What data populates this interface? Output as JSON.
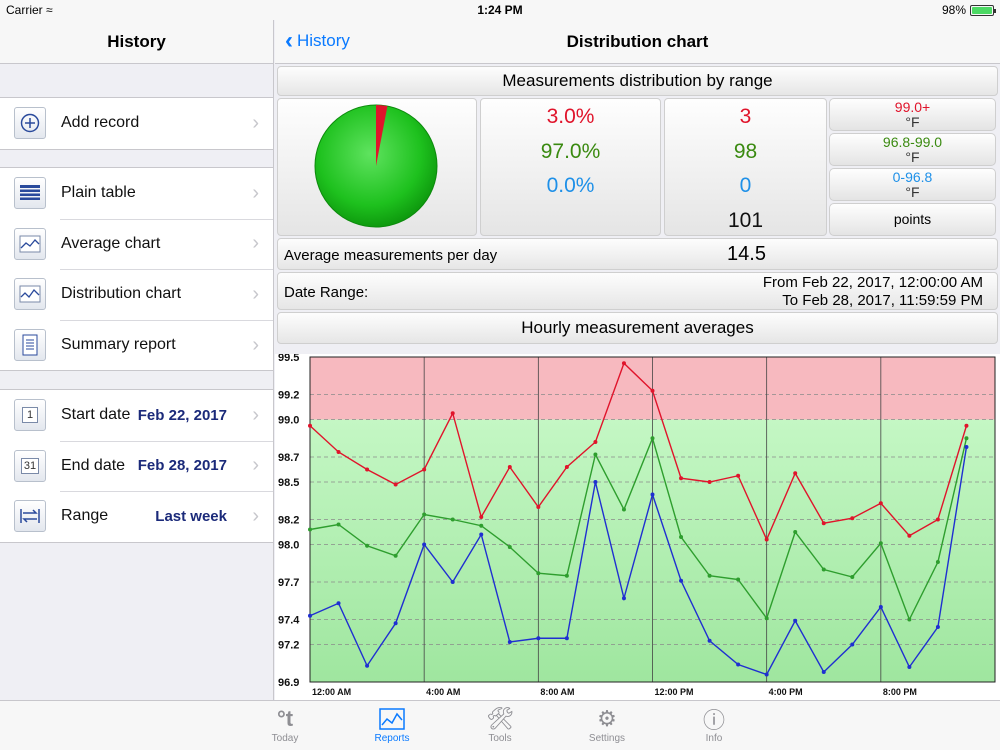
{
  "status": {
    "carrier": "Carrier",
    "time": "1:24 PM",
    "battery": "98%"
  },
  "sidebar": {
    "title": "History",
    "add_record": "Add record",
    "reports": [
      {
        "label": "Plain table",
        "icon": "table-icon"
      },
      {
        "label": "Average chart",
        "icon": "line-chart-icon"
      },
      {
        "label": "Distribution chart",
        "icon": "line-chart-icon"
      },
      {
        "label": "Summary report",
        "icon": "document-icon"
      }
    ],
    "start_date": {
      "label": "Start date",
      "value": "Feb 22, 2017",
      "icon_text": "1"
    },
    "end_date": {
      "label": "End date",
      "value": "Feb 28, 2017",
      "icon_text": "31"
    },
    "range": {
      "label": "Range",
      "value": "Last week"
    }
  },
  "main": {
    "back_label": "History",
    "title": "Distribution chart",
    "distribution_title": "Measurements distribution by range",
    "percentages": [
      "3.0%",
      "97.0%",
      "0.0%"
    ],
    "counts": [
      "3",
      "98",
      "0"
    ],
    "total": "101",
    "ranges": [
      {
        "range": "99.0+",
        "unit": "°F"
      },
      {
        "range": "96.8-99.0",
        "unit": "°F"
      },
      {
        "range": "0-96.8",
        "unit": "°F"
      }
    ],
    "points_label": "points",
    "avg_label": "Average measurements per day",
    "avg_value": "14.5",
    "date_range_label": "Date Range:",
    "date_from": "From Feb 22, 2017, 12:00:00 AM",
    "date_to": "To Feb 28, 2017, 11:59:59 PM",
    "hourly_title": "Hourly measurement averages"
  },
  "colors": {
    "high": "#e0142b",
    "normal": "#3a8a10",
    "low": "#1e90e8",
    "tint": "#0a7aff"
  },
  "pie": {
    "high_fraction": 0.03,
    "normal_fraction": 0.97,
    "low_fraction": 0.0
  },
  "chart_data": {
    "type": "line",
    "x_tick_labels": [
      "12:00 AM",
      "4:00 AM",
      "8:00 AM",
      "12:00 PM",
      "4:00 PM",
      "8:00 PM"
    ],
    "x_hours": [
      0,
      1,
      2,
      3,
      4,
      5,
      6,
      7,
      8,
      9,
      10,
      11,
      12,
      13,
      14,
      15,
      16,
      17,
      18,
      19,
      20,
      21,
      22,
      23
    ],
    "y_ticks": [
      96.9,
      97.2,
      97.4,
      97.7,
      98.0,
      98.2,
      98.5,
      98.7,
      99.0,
      99.2,
      99.5
    ],
    "ylim": [
      96.9,
      99.5
    ],
    "high_band_from": 99.0,
    "series": [
      {
        "color": "#e0142b",
        "values": [
          98.95,
          98.74,
          98.6,
          98.48,
          98.6,
          99.05,
          98.22,
          98.62,
          98.3,
          98.62,
          98.82,
          99.45,
          99.23,
          98.53,
          98.5,
          98.55,
          98.04,
          98.57,
          98.17,
          98.21,
          98.33,
          98.07,
          98.2,
          98.95
        ]
      },
      {
        "color": "#2e9e2e",
        "values": [
          98.12,
          98.16,
          97.99,
          97.91,
          98.24,
          98.2,
          98.15,
          97.98,
          97.77,
          97.75,
          98.72,
          98.28,
          98.85,
          98.06,
          97.75,
          97.72,
          97.41,
          98.1,
          97.8,
          97.74,
          98.01,
          97.4,
          97.86,
          98.85
        ]
      },
      {
        "color": "#1f2fd1",
        "values": [
          97.43,
          97.53,
          97.03,
          97.37,
          98.0,
          97.7,
          98.08,
          97.22,
          97.25,
          97.25,
          98.5,
          97.57,
          98.4,
          97.71,
          97.23,
          97.04,
          96.96,
          97.39,
          96.98,
          97.2,
          97.5,
          97.02,
          97.34,
          98.78
        ]
      }
    ]
  },
  "tabs": [
    {
      "label": "Today",
      "icon": "°t",
      "active": false
    },
    {
      "label": "Reports",
      "icon": "chart",
      "active": true
    },
    {
      "label": "Tools",
      "icon": "🛠",
      "active": false
    },
    {
      "label": "Settings",
      "icon": "⚙",
      "active": false
    },
    {
      "label": "Info",
      "icon": "ⓘ",
      "active": false
    }
  ]
}
